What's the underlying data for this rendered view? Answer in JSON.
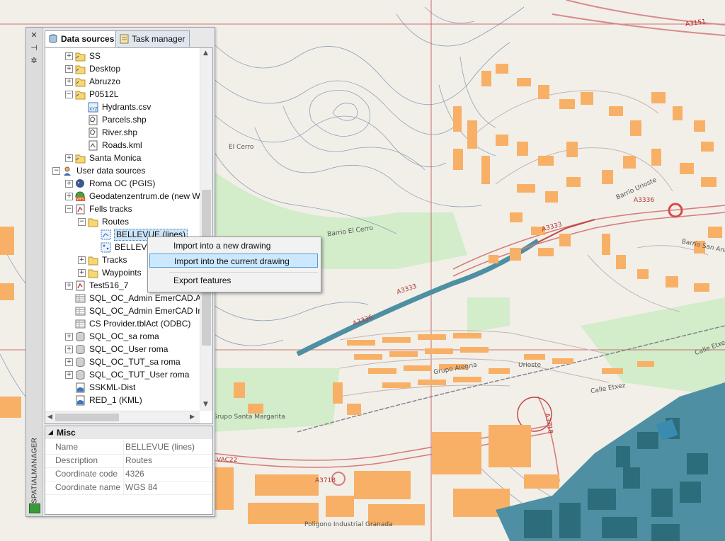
{
  "palette": {
    "sidebar_title": "SPATIALMANAGER",
    "tabs": [
      {
        "label": "Data sources",
        "active": true
      },
      {
        "label": "Task manager",
        "active": false
      }
    ],
    "tree": [
      {
        "label": "SS",
        "icon": "folder-link-icon"
      },
      {
        "label": "Desktop",
        "icon": "folder-link-icon"
      },
      {
        "label": "Abruzzo",
        "icon": "folder-link-icon"
      },
      {
        "label": "P0512L",
        "icon": "folder-link-icon"
      },
      {
        "label": "Hydrants.csv",
        "icon": "xyz-file-icon"
      },
      {
        "label": "Parcels.shp",
        "icon": "shp-file-icon"
      },
      {
        "label": "River.shp",
        "icon": "shp-file-icon"
      },
      {
        "label": "Roads.kml",
        "icon": "kml-file-icon"
      },
      {
        "label": "Santa Monica",
        "icon": "folder-link-icon"
      },
      {
        "label": "User data sources",
        "icon": "user-icon"
      },
      {
        "label": "Roma OC (PGIS)",
        "icon": "postgis-icon"
      },
      {
        "label": "Geodatenzentrum.de (new W",
        "icon": "wfs-icon"
      },
      {
        "label": "Fells tracks",
        "icon": "gpx-icon"
      },
      {
        "label": "Routes",
        "icon": "folder-icon"
      },
      {
        "label": "BELLEVUE (lines)",
        "icon": "line-layer-icon"
      },
      {
        "label": "BELLEVUE",
        "icon": "point-layer-icon"
      },
      {
        "label": "Tracks",
        "icon": "folder-icon"
      },
      {
        "label": "Waypoints",
        "icon": "folder-icon"
      },
      {
        "label": "Test516_7",
        "icon": "gpx-icon"
      },
      {
        "label": "SQL_OC_Admin EmerCAD.Ac",
        "icon": "table-icon"
      },
      {
        "label": "SQL_OC_Admin EmerCAD In",
        "icon": "table-icon"
      },
      {
        "label": "CS Provider.tblAct (ODBC)",
        "icon": "table-icon"
      },
      {
        "label": "SQL_OC_sa roma",
        "icon": "database-icon"
      },
      {
        "label": "SQL_OC_User roma",
        "icon": "database-icon"
      },
      {
        "label": "SQL_OC_TUT_sa roma",
        "icon": "database-icon"
      },
      {
        "label": "SQL_OC_TUT_User roma",
        "icon": "database-icon"
      },
      {
        "label": "SSKML-Dist",
        "icon": "kml-doc-icon"
      },
      {
        "label": "RED_1 (KML)",
        "icon": "kml-doc-icon"
      }
    ],
    "properties": {
      "section": "Misc",
      "rows": [
        {
          "name": "Name",
          "value": "BELLEVUE (lines)"
        },
        {
          "name": "Description",
          "value": "Routes"
        },
        {
          "name": "Coordinate code",
          "value": "4326"
        },
        {
          "name": "Coordinate name",
          "value": "WGS 84"
        }
      ]
    }
  },
  "context_menu": {
    "items": [
      "Import into a new drawing",
      "Import into the current drawing",
      "Export features"
    ],
    "highlighted_index": 1
  },
  "map": {
    "labels": [
      "El Cerro",
      "Barrio El Cerro",
      "A3333",
      "A3336",
      "A3718",
      "Uriosteko",
      "Grupo Alegria",
      "Calle Etxezuri",
      "Barrio Urioste",
      "Barrio San Ant",
      "Poligono Industrial Granada",
      "Grupo Santa Margarita",
      "A3151",
      "Urioste",
      "Calle Etxez",
      "VAC22"
    ],
    "colors": {
      "background": "#f2efe9",
      "buildings": "#f8b066",
      "buildings_dark": "#2d6c7a",
      "roads_major": "#e08c8c",
      "water": "#4f8fa3",
      "green": "#cdebc5"
    }
  }
}
